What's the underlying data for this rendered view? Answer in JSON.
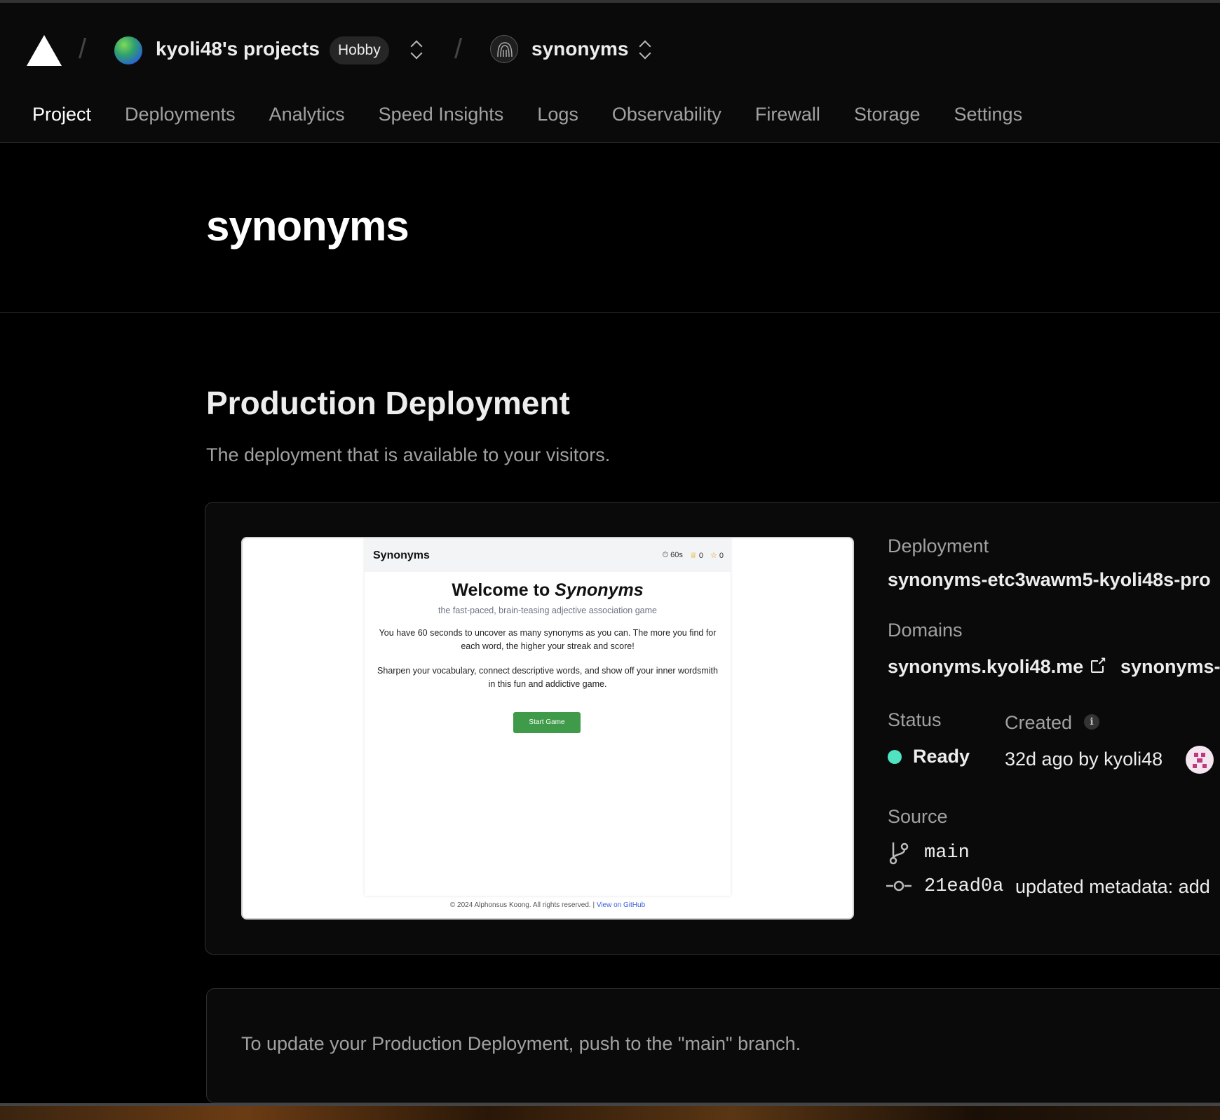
{
  "header": {
    "team_name": "kyoli48's projects",
    "plan_badge": "Hobby",
    "project_name": "synonyms"
  },
  "tabs": [
    {
      "label": "Project",
      "active": true
    },
    {
      "label": "Deployments"
    },
    {
      "label": "Analytics"
    },
    {
      "label": "Speed Insights"
    },
    {
      "label": "Logs"
    },
    {
      "label": "Observability"
    },
    {
      "label": "Firewall"
    },
    {
      "label": "Storage"
    },
    {
      "label": "Settings"
    }
  ],
  "page": {
    "title": "synonyms"
  },
  "production": {
    "title": "Production Deployment",
    "subtitle": "The deployment that is available to your visitors.",
    "preview": {
      "brand": "Synonyms",
      "timer": "60s",
      "trophy": "0",
      "stars": "0",
      "welcome_prefix": "Welcome to ",
      "welcome_name": "Synonyms",
      "tagline": "the fast-paced, brain-teasing adjective association game",
      "para1": "You have 60 seconds to uncover as many synonyms as you can. The more you find for each word, the higher your streak and score!",
      "para2": "Sharpen your vocabulary, connect descriptive words, and show off your inner wordsmith in this fun and addictive game.",
      "button": "Start Game",
      "footer": "© 2024 Alphonsus Koong. All rights reserved. |",
      "footer_link": "View on GitHub"
    },
    "deployment_label": "Deployment",
    "deployment_value": "synonyms-etc3wawm5-kyoli48s-pro",
    "domains_label": "Domains",
    "domain_primary": "synonyms.kyoli48.me",
    "domain_secondary": "synonyms-",
    "status_label": "Status",
    "status_value": "Ready",
    "status_color": "#50e3c2",
    "created_label": "Created",
    "created_value": "32d ago by kyoli48",
    "source_label": "Source",
    "branch": "main",
    "commit_hash": "21ead0a",
    "commit_message": "updated metadata: add"
  },
  "notice": {
    "text": "To update your Production Deployment, push to the \"main\" branch."
  }
}
